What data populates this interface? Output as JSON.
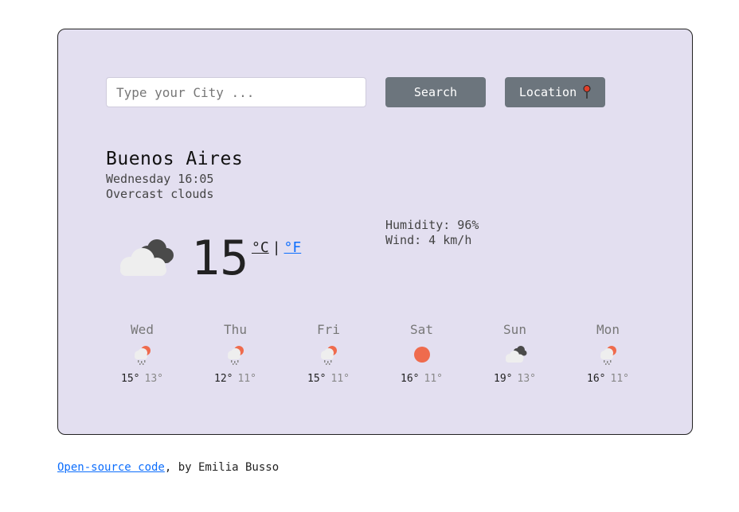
{
  "search": {
    "placeholder": "Type your City ...",
    "value": ""
  },
  "buttons": {
    "search_label": "Search",
    "location_label": "Location"
  },
  "current": {
    "city": "Buenos Aires",
    "date": "Wednesday 16:05",
    "description": "Overcast clouds",
    "temperature": "15",
    "unit_c": "°C",
    "unit_sep": "|",
    "unit_f": "°F",
    "humidity": "Humidity: 96%",
    "wind": "Wind: 4 km/h",
    "icon": "overcast-clouds-icon"
  },
  "forecast": [
    {
      "day": "Wed",
      "max": "15°",
      "min": "13°",
      "icon": "rain-sun-icon"
    },
    {
      "day": "Thu",
      "max": "12°",
      "min": "11°",
      "icon": "rain-sun-icon"
    },
    {
      "day": "Fri",
      "max": "15°",
      "min": "11°",
      "icon": "rain-sun-icon"
    },
    {
      "day": "Sat",
      "max": "16°",
      "min": "11°",
      "icon": "sun-icon"
    },
    {
      "day": "Sun",
      "max": "19°",
      "min": "13°",
      "icon": "cloudy-icon"
    },
    {
      "day": "Mon",
      "max": "16°",
      "min": "11°",
      "icon": "rain-sun-icon"
    }
  ],
  "footer": {
    "link_text": "Open-source code",
    "suffix": ", by Emilia Busso"
  },
  "colors": {
    "card_bg": "#e3dff0",
    "button_bg": "#6c757d",
    "link": "#0d6efd",
    "sun": "#ef6b4d",
    "dark_cloud": "#4a4a4a",
    "light_cloud": "#eeeeee"
  }
}
